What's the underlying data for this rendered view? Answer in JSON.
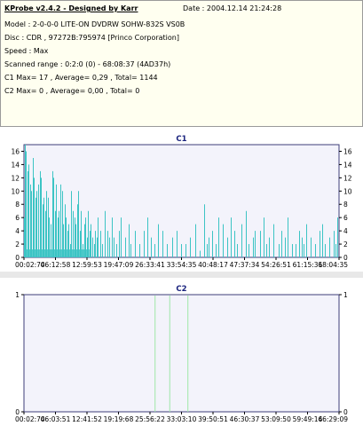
{
  "header": {
    "app_title": "KProbe v2.4.2 - Designed by Karr",
    "date": "Date : 2004.12.14 21:24:28",
    "lines": [
      "Model : 2-0-0-0 LITE-ON DVDRW SOHW-832S  VS0B",
      "Disc : CDR , 97272B:795974 [Princo Corporation]",
      "Speed : Max",
      "Scanned range : 0:2:0 (0) - 68:08:37 (4AD37h)",
      "C1 Max= 17 , Average= 0,29 , Total= 1144",
      "C2 Max= 0 , Average= 0,00 , Total= 0"
    ]
  },
  "colors": {
    "plot_bg": "#f3f3fb",
    "c1_series": "#3cc4c4",
    "c2_series": "#9fe8a8",
    "frame": "#3c3c78",
    "title": "#1a237e"
  },
  "chart_data": [
    {
      "type": "bar",
      "title": "C1",
      "ylim": [
        0,
        17
      ],
      "yticks": [
        "0",
        "2",
        "4",
        "6",
        "8",
        "10",
        "12",
        "14",
        "16"
      ],
      "xticks": [
        "00:02:74",
        "06:12:58",
        "12:59:53",
        "19:47:09",
        "26:33:41",
        "33:54:35",
        "40:48:17",
        "47:37:34",
        "54:26:51",
        "61:15:31",
        "68:04:35"
      ],
      "x_range_minutes": [
        0.04,
        68.14
      ],
      "series": [
        {
          "x": [
            0.1,
            0.2,
            0.5,
            0.8,
            1.0,
            1.3,
            1.6,
            1.9,
            2.2,
            2.5,
            2.8,
            3.1,
            3.4,
            3.7,
            4.0,
            4.3,
            4.6,
            4.9,
            5.2,
            5.5,
            5.8,
            6.1,
            6.4,
            6.7,
            7.0,
            7.3,
            7.6,
            7.9,
            8.2,
            8.5,
            8.8,
            9.1,
            9.4,
            9.7,
            10.0,
            10.3,
            10.6,
            10.9,
            11.2,
            11.5,
            11.8,
            12.1,
            12.4,
            12.7,
            13.0,
            13.3,
            13.6,
            13.9,
            14.2,
            14.5,
            14.8,
            15.1,
            15.4,
            15.7,
            16.0,
            16.5,
            17.0,
            17.5,
            18.0,
            18.5,
            19.0,
            19.5,
            20.0,
            20.5,
            21.0,
            22.0,
            22.6,
            23.0,
            24.0,
            25.0,
            26.0,
            26.7,
            27.5,
            28.3,
            29.0,
            30.0,
            31.0,
            32.0,
            33.0,
            34.0,
            35.0,
            36.0,
            37.0,
            38.0,
            38.9,
            39.5,
            40.0,
            40.8,
            41.5,
            42.0,
            43.0,
            44.0,
            44.7,
            45.5,
            46.0,
            47.0,
            48.0,
            48.6,
            49.5,
            50.0,
            51.0,
            51.8,
            52.5,
            53.0,
            54.0,
            55.0,
            55.6,
            56.5,
            57.0,
            58.0,
            58.8,
            59.5,
            60.0,
            60.5,
            61.0,
            62.0,
            63.0,
            64.0,
            64.5,
            65.0,
            66.0,
            67.0,
            67.4,
            67.8
          ],
          "values": [
            6,
            17,
            16,
            13,
            14,
            11,
            10,
            15,
            12,
            9,
            10,
            11,
            13,
            12,
            8,
            9,
            7,
            10,
            9,
            6,
            5,
            13,
            12,
            7,
            11,
            6,
            7,
            11,
            10,
            5,
            8,
            6,
            4,
            5,
            2,
            10,
            7,
            6,
            5,
            8,
            10,
            4,
            7,
            2,
            5,
            6,
            3,
            7,
            4,
            5,
            3,
            2,
            4,
            3,
            6,
            4,
            2,
            7,
            4,
            3,
            6,
            3,
            2,
            4,
            6,
            3,
            5,
            2,
            4,
            2,
            4,
            6,
            3,
            2,
            5,
            4,
            2,
            3,
            4,
            2,
            2,
            3,
            5,
            1,
            8,
            2,
            3,
            4,
            2,
            6,
            5,
            3,
            6,
            4,
            2,
            5,
            7,
            2,
            3,
            4,
            4,
            6,
            2,
            3,
            5,
            2,
            4,
            3,
            6,
            2,
            2,
            4,
            3,
            2,
            5,
            3,
            2,
            4,
            5,
            2,
            3,
            4,
            2,
            6
          ]
        }
      ]
    },
    {
      "type": "bar",
      "title": "C2",
      "ylim": [
        0,
        1
      ],
      "yticks": [
        "0",
        "1"
      ],
      "xticks": [
        "00:02:74",
        "06:03:51",
        "12:41:52",
        "19:19:68",
        "25:56:22",
        "33:03:10",
        "39:50:51",
        "46:30:37",
        "53:09:50",
        "59:49:14",
        "66:29:09"
      ],
      "x_range_minutes": [
        0.04,
        73.0
      ],
      "series": [
        {
          "x": [],
          "values": []
        }
      ],
      "markers_minutes": [
        30.4,
        33.8,
        38.0
      ]
    }
  ]
}
